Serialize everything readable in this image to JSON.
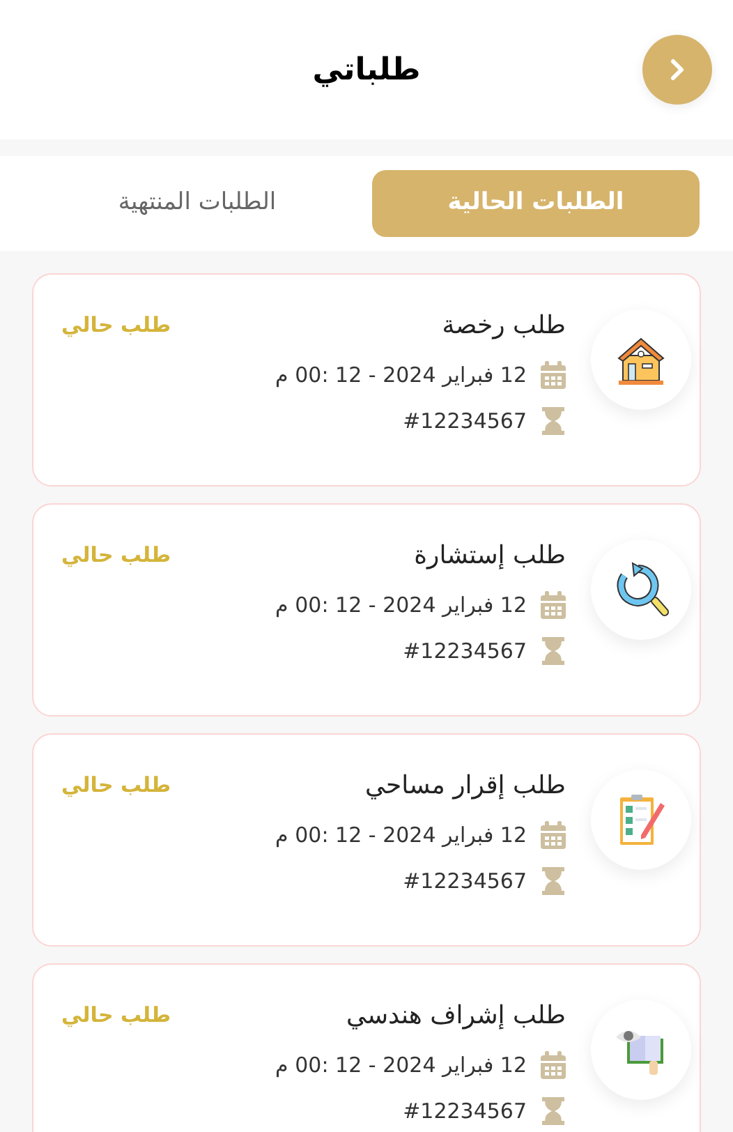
{
  "header": {
    "title": "طلباتي"
  },
  "tabs": [
    {
      "label": "الطلبات الحالية",
      "selected": true
    },
    {
      "label": "الطلبات المنتهية",
      "selected": false
    }
  ],
  "requests": [
    {
      "kind": "house",
      "title": "طلب رخصة",
      "date": "12 فبراير 2024 - 12 :00 م",
      "number": "#12234567",
      "status": "طلب حالي"
    },
    {
      "kind": "refresh",
      "title": "طلب إستشارة",
      "date": "12 فبراير 2024 - 12 :00 م",
      "number": "#12234567",
      "status": "طلب حالي"
    },
    {
      "kind": "checklist",
      "title": "طلب إقرار مساحي",
      "date": "12 فبراير 2024 - 12 :00 م",
      "number": "#12234567",
      "status": "طلب حالي"
    },
    {
      "kind": "book",
      "title": "طلب إشراف هندسي",
      "date": "12 فبراير 2024 - 12 :00 م",
      "number": "#12234567",
      "status": "طلب حالي"
    }
  ]
}
